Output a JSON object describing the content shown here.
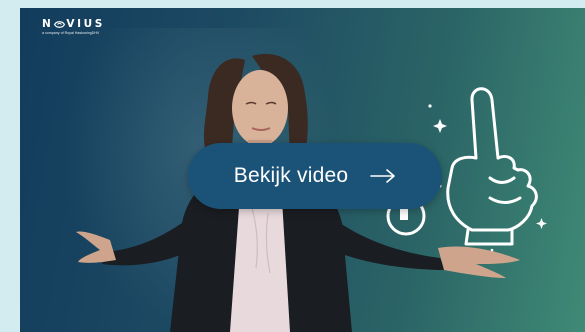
{
  "brand": {
    "name": "N●VIUS",
    "name_prefix": "N",
    "name_suffix": "VIUS",
    "tagline": "a company of Royal HaskoningDHV"
  },
  "video": {
    "cta_label": "Bekijk video"
  },
  "icons": {
    "logo_mark": "eye-o-icon",
    "arrow": "arrow-right-icon",
    "illustration": "pointing-hand-illustration"
  },
  "colors": {
    "background_outer": "#d3ecef",
    "video_dark": "#123c5c",
    "video_light": "#3f8a76",
    "button": "#1b5378",
    "text": "#ffffff"
  }
}
